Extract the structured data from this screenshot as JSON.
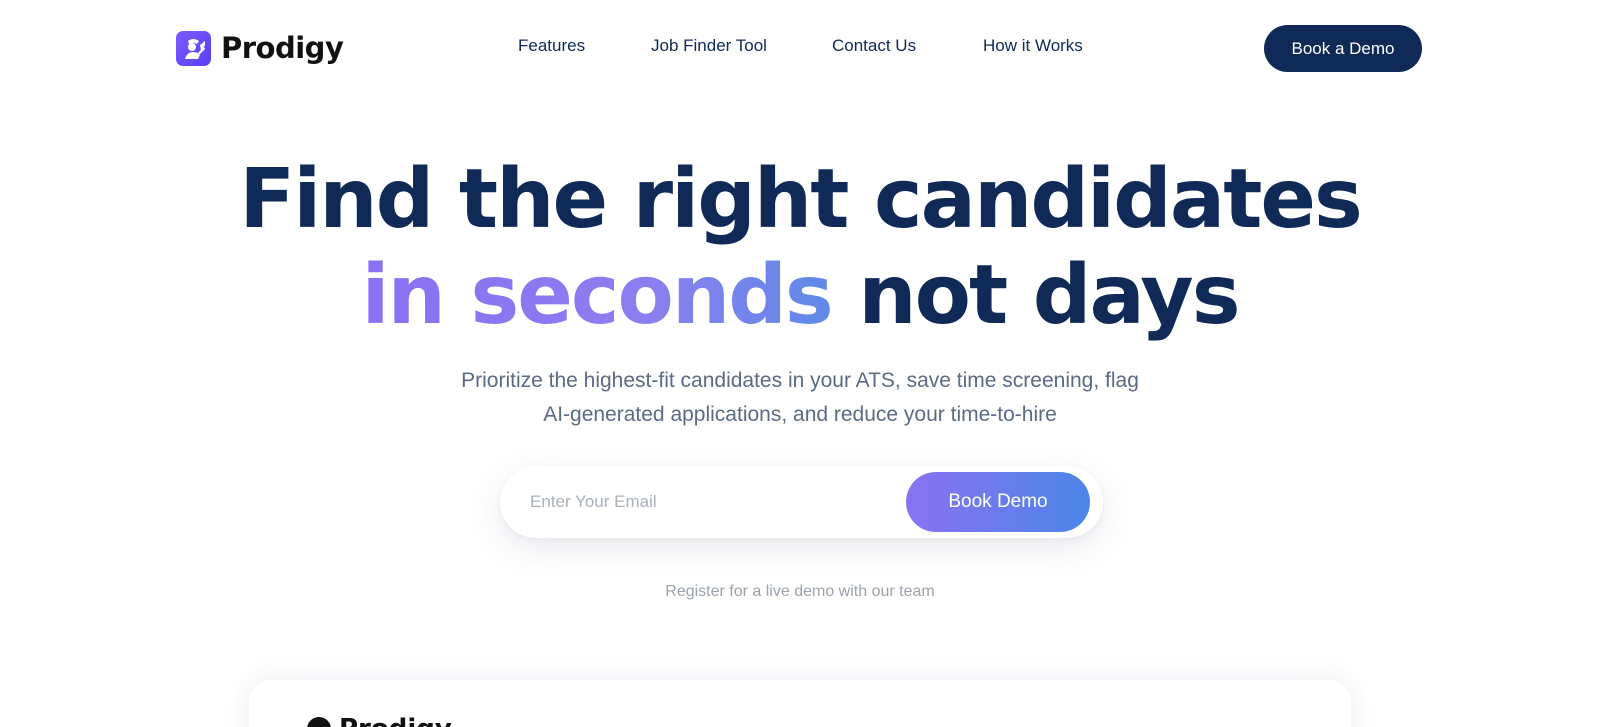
{
  "brand": {
    "name": "Prodigy",
    "logo_icon": "prodigy-logo-icon",
    "accent_color": "#6b4cf6",
    "navy_color": "#0f2a56"
  },
  "nav": {
    "links": [
      {
        "label": "Features"
      },
      {
        "label": "Job Finder Tool"
      },
      {
        "label": "Contact Us"
      },
      {
        "label": "How it Works"
      }
    ],
    "cta_label": "Book a Demo"
  },
  "hero": {
    "title_line1": "Find the right candidates",
    "title_highlight": "in seconds",
    "title_rest": "not days",
    "subtitle_line1": "Prioritize the highest-fit candidates in your ATS, save time screening, flag",
    "subtitle_line2": "AI-generated applications, and reduce your time-to-hire",
    "gradient_colors": [
      "#8a72f2",
      "#4b86e6"
    ]
  },
  "signup": {
    "email_placeholder": "Enter Your Email",
    "email_value": "",
    "submit_label": "Book Demo",
    "note": "Register for a live demo with our team"
  },
  "preview": {
    "brand_name": "Prodigy"
  }
}
